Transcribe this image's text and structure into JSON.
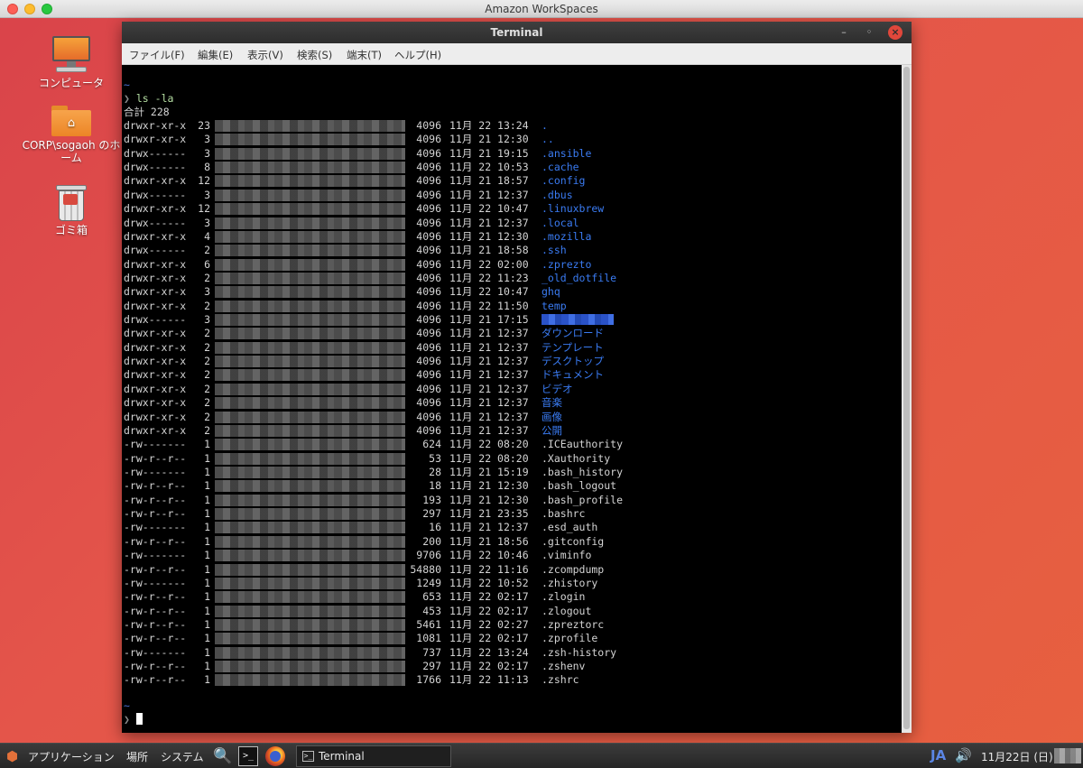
{
  "app_window": {
    "title": "Amazon WorkSpaces"
  },
  "desktop": {
    "icons": [
      {
        "label": "コンピュータ"
      },
      {
        "label": "CORP\\sogaoh のホーム"
      },
      {
        "label": "ゴミ箱"
      }
    ]
  },
  "terminal": {
    "title": "Terminal",
    "menu": [
      "ファイル(F)",
      "編集(E)",
      "表示(V)",
      "検索(S)",
      "端末(T)",
      "ヘルプ(H)"
    ],
    "prompt_tilde": "~",
    "prompt_symbol": "❯",
    "command": "ls -la",
    "total_line": "合計 228",
    "entries": [
      {
        "perm": "drwxr-xr-x",
        "links": "23",
        "size": "4096",
        "date": "11月 22 13:24",
        "name": ".",
        "kind": "dir"
      },
      {
        "perm": "drwxr-xr-x",
        "links": "3",
        "size": "4096",
        "date": "11月 21 12:30",
        "name": "..",
        "kind": "dir"
      },
      {
        "perm": "drwx------",
        "links": "3",
        "size": "4096",
        "date": "11月 21 19:15",
        "name": ".ansible",
        "kind": "dir"
      },
      {
        "perm": "drwx------",
        "links": "8",
        "size": "4096",
        "date": "11月 22 10:53",
        "name": ".cache",
        "kind": "dir"
      },
      {
        "perm": "drwxr-xr-x",
        "links": "12",
        "size": "4096",
        "date": "11月 21 18:57",
        "name": ".config",
        "kind": "dir"
      },
      {
        "perm": "drwx------",
        "links": "3",
        "size": "4096",
        "date": "11月 21 12:37",
        "name": ".dbus",
        "kind": "dir"
      },
      {
        "perm": "drwxr-xr-x",
        "links": "12",
        "size": "4096",
        "date": "11月 22 10:47",
        "name": ".linuxbrew",
        "kind": "dir"
      },
      {
        "perm": "drwx------",
        "links": "3",
        "size": "4096",
        "date": "11月 21 12:37",
        "name": ".local",
        "kind": "dir"
      },
      {
        "perm": "drwxr-xr-x",
        "links": "4",
        "size": "4096",
        "date": "11月 21 12:30",
        "name": ".mozilla",
        "kind": "dir"
      },
      {
        "perm": "drwx------",
        "links": "2",
        "size": "4096",
        "date": "11月 21 18:58",
        "name": ".ssh",
        "kind": "dir"
      },
      {
        "perm": "drwxr-xr-x",
        "links": "6",
        "size": "4096",
        "date": "11月 22 02:00",
        "name": ".zprezto",
        "kind": "dir"
      },
      {
        "perm": "drwxr-xr-x",
        "links": "2",
        "size": "4096",
        "date": "11月 22 11:23",
        "name": "_old_dotfile",
        "kind": "dir"
      },
      {
        "perm": "drwxr-xr-x",
        "links": "3",
        "size": "4096",
        "date": "11月 22 10:47",
        "name": "ghq",
        "kind": "dir"
      },
      {
        "perm": "drwxr-xr-x",
        "links": "2",
        "size": "4096",
        "date": "11月 22 11:50",
        "name": "temp",
        "kind": "dir"
      },
      {
        "perm": "drwx------",
        "links": "3",
        "size": "4096",
        "date": "11月 21 17:15",
        "name": "",
        "kind": "redacted"
      },
      {
        "perm": "drwxr-xr-x",
        "links": "2",
        "size": "4096",
        "date": "11月 21 12:37",
        "name": "ダウンロード",
        "kind": "dir"
      },
      {
        "perm": "drwxr-xr-x",
        "links": "2",
        "size": "4096",
        "date": "11月 21 12:37",
        "name": "テンプレート",
        "kind": "dir"
      },
      {
        "perm": "drwxr-xr-x",
        "links": "2",
        "size": "4096",
        "date": "11月 21 12:37",
        "name": "デスクトップ",
        "kind": "dir"
      },
      {
        "perm": "drwxr-xr-x",
        "links": "2",
        "size": "4096",
        "date": "11月 21 12:37",
        "name": "ドキュメント",
        "kind": "dir"
      },
      {
        "perm": "drwxr-xr-x",
        "links": "2",
        "size": "4096",
        "date": "11月 21 12:37",
        "name": "ビデオ",
        "kind": "dir"
      },
      {
        "perm": "drwxr-xr-x",
        "links": "2",
        "size": "4096",
        "date": "11月 21 12:37",
        "name": "音楽",
        "kind": "dir"
      },
      {
        "perm": "drwxr-xr-x",
        "links": "2",
        "size": "4096",
        "date": "11月 21 12:37",
        "name": "画像",
        "kind": "dir"
      },
      {
        "perm": "drwxr-xr-x",
        "links": "2",
        "size": "4096",
        "date": "11月 21 12:37",
        "name": "公開",
        "kind": "dir"
      },
      {
        "perm": "-rw-------",
        "links": "1",
        "size": "624",
        "date": "11月 22 08:20",
        "name": ".ICEauthority",
        "kind": "file"
      },
      {
        "perm": "-rw-r--r--",
        "links": "1",
        "size": "53",
        "date": "11月 22 08:20",
        "name": ".Xauthority",
        "kind": "file"
      },
      {
        "perm": "-rw-------",
        "links": "1",
        "size": "28",
        "date": "11月 21 15:19",
        "name": ".bash_history",
        "kind": "file"
      },
      {
        "perm": "-rw-r--r--",
        "links": "1",
        "size": "18",
        "date": "11月 21 12:30",
        "name": ".bash_logout",
        "kind": "file"
      },
      {
        "perm": "-rw-r--r--",
        "links": "1",
        "size": "193",
        "date": "11月 21 12:30",
        "name": ".bash_profile",
        "kind": "file"
      },
      {
        "perm": "-rw-r--r--",
        "links": "1",
        "size": "297",
        "date": "11月 21 23:35",
        "name": ".bashrc",
        "kind": "file"
      },
      {
        "perm": "-rw-------",
        "links": "1",
        "size": "16",
        "date": "11月 21 12:37",
        "name": ".esd_auth",
        "kind": "file"
      },
      {
        "perm": "-rw-r--r--",
        "links": "1",
        "size": "200",
        "date": "11月 21 18:56",
        "name": ".gitconfig",
        "kind": "file"
      },
      {
        "perm": "-rw-------",
        "links": "1",
        "size": "9706",
        "date": "11月 22 10:46",
        "name": ".viminfo",
        "kind": "file"
      },
      {
        "perm": "-rw-r--r--",
        "links": "1",
        "size": "54880",
        "date": "11月 22 11:16",
        "name": ".zcompdump",
        "kind": "file"
      },
      {
        "perm": "-rw-------",
        "links": "1",
        "size": "1249",
        "date": "11月 22 10:52",
        "name": ".zhistory",
        "kind": "file"
      },
      {
        "perm": "-rw-r--r--",
        "links": "1",
        "size": "653",
        "date": "11月 22 02:17",
        "name": ".zlogin",
        "kind": "file"
      },
      {
        "perm": "-rw-r--r--",
        "links": "1",
        "size": "453",
        "date": "11月 22 02:17",
        "name": ".zlogout",
        "kind": "file"
      },
      {
        "perm": "-rw-r--r--",
        "links": "1",
        "size": "5461",
        "date": "11月 22 02:27",
        "name": ".zpreztorc",
        "kind": "file"
      },
      {
        "perm": "-rw-r--r--",
        "links": "1",
        "size": "1081",
        "date": "11月 22 02:17",
        "name": ".zprofile",
        "kind": "file"
      },
      {
        "perm": "-rw-------",
        "links": "1",
        "size": "737",
        "date": "11月 22 13:24",
        "name": ".zsh-history",
        "kind": "file"
      },
      {
        "perm": "-rw-r--r--",
        "links": "1",
        "size": "297",
        "date": "11月 22 02:17",
        "name": ".zshenv",
        "kind": "file"
      },
      {
        "perm": "-rw-r--r--",
        "links": "1",
        "size": "1766",
        "date": "11月 22 11:13",
        "name": ".zshrc",
        "kind": "file"
      }
    ]
  },
  "taskbar": {
    "applications_label": "アプリケーション",
    "places_label": "場所",
    "system_label": "システム",
    "terminal_launcher_label": ">_",
    "task_item_label": "Terminal",
    "ime_label": "JA",
    "clock": "11月22日 (日)"
  },
  "icons": {
    "applications": "applications-icon",
    "search": "search-icon",
    "terminal": "terminal-icon",
    "browser": "firefox-icon",
    "volume": "volume-icon"
  }
}
